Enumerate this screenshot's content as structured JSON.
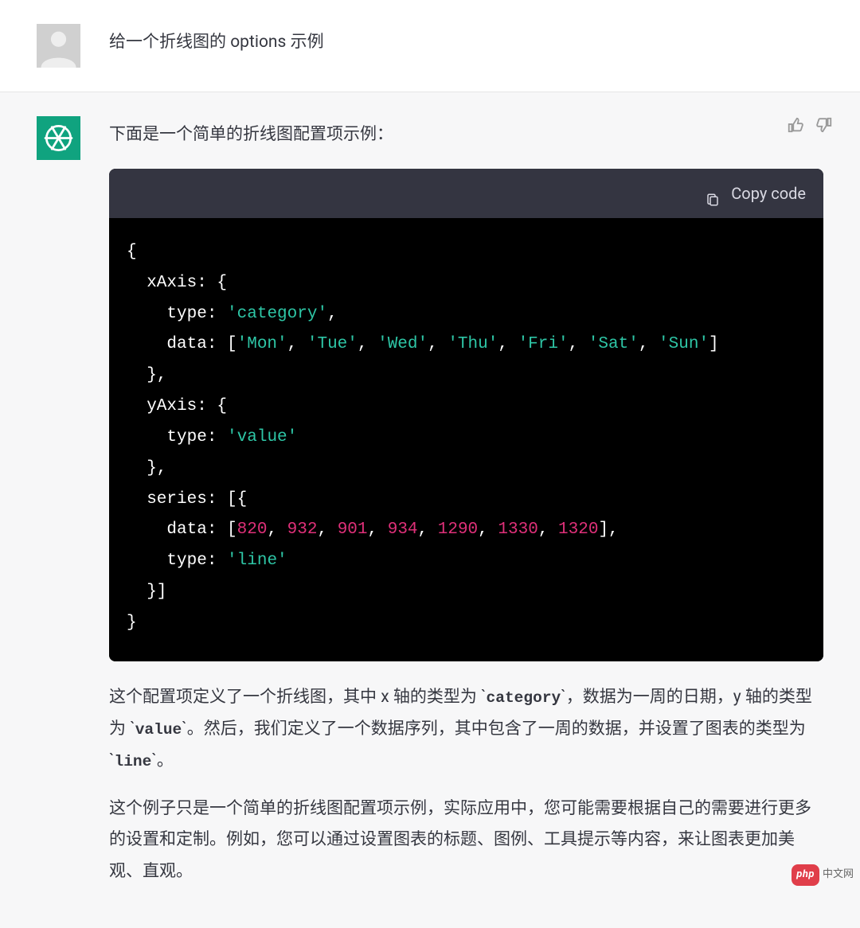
{
  "user": {
    "message": "给一个折线图的 options  示例"
  },
  "assistant": {
    "intro": "下面是一个简单的折线图配置项示例：",
    "actions": {
      "like": "thumbs-up",
      "dislike": "thumbs-down"
    },
    "code": {
      "copy_label": "Copy code",
      "line1": "{",
      "line2_a": "  xAxis: {",
      "line3_key": "    type: ",
      "line3_val": "'category'",
      "line3_tail": ",",
      "line4_key": "    data: [",
      "line4_vals": [
        "'Mon'",
        "'Tue'",
        "'Wed'",
        "'Thu'",
        "'Fri'",
        "'Sat'",
        "'Sun'"
      ],
      "line4_tail": "]",
      "line5": "  },",
      "line6": "  yAxis: {",
      "line7_key": "    type: ",
      "line7_val": "'value'",
      "line8": "  },",
      "line9": "  series: [{",
      "line10_key": "    data: [",
      "line10_vals": [
        "820",
        "932",
        "901",
        "934",
        "1290",
        "1330",
        "1320"
      ],
      "line10_tail": "],",
      "line11_key": "    type: ",
      "line11_val": "'line'",
      "line12": "  }]",
      "line13": "}"
    },
    "explain": {
      "p1_a": "这个配置项定义了一个折线图，其中 x 轴的类型为 `",
      "p1_c1": "category",
      "p1_b": "`，数据为一周的日期，y 轴的类型为 `",
      "p1_c2": "value",
      "p1_c": "`。然后，我们定义了一个数据序列，其中包含了一周的数据，并设置了图表的类型为 `",
      "p1_c3": "line",
      "p1_d": "`。",
      "p2": "这个例子只是一个简单的折线图配置项示例，实际应用中，您可能需要根据自己的需要进行更多的设置和定制。例如，您可以通过设置图表的标题、图例、工具提示等内容，来让图表更加美观、直观。"
    }
  },
  "watermark": {
    "badge": "php",
    "text": "中文网"
  },
  "chart_data": {
    "type": "line",
    "categories": [
      "Mon",
      "Tue",
      "Wed",
      "Thu",
      "Fri",
      "Sat",
      "Sun"
    ],
    "values": [
      820,
      932,
      901,
      934,
      1290,
      1330,
      1320
    ],
    "xAxisType": "category",
    "yAxisType": "value",
    "title": "",
    "xlabel": "",
    "ylabel": ""
  }
}
